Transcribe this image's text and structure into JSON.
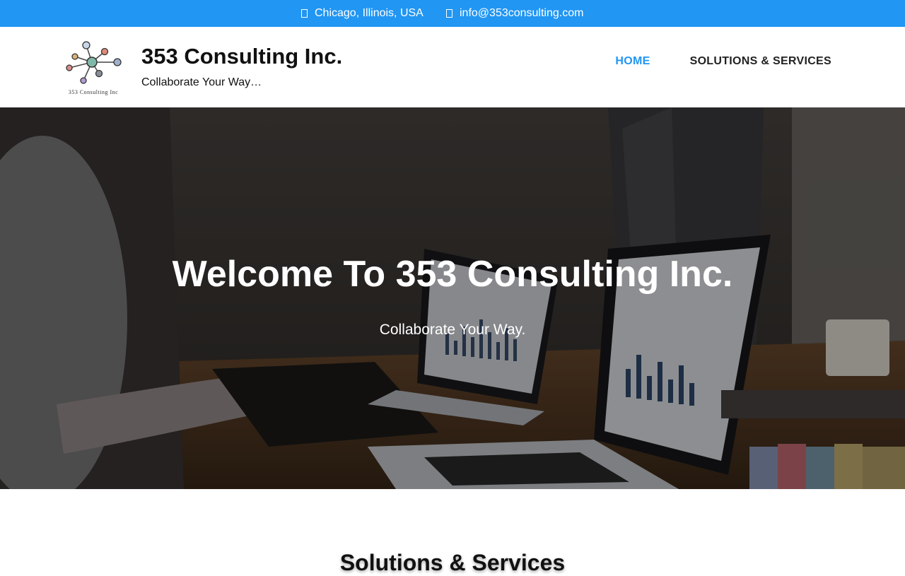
{
  "topbar": {
    "location_icon": "map-marker-icon",
    "location": "Chicago, Illinois, USA",
    "email_icon": "envelope-icon",
    "email": "info@353consulting.com",
    "bg_color": "#2196f3"
  },
  "header": {
    "logo_caption": "353 Consulting Inc",
    "title": "353 Consulting Inc.",
    "tagline": "Collaborate Your Way…"
  },
  "nav": {
    "items": [
      {
        "label": "HOME",
        "active": true
      },
      {
        "label": "SOLUTIONS & SERVICES",
        "active": false
      }
    ],
    "active_color": "#2196f3"
  },
  "hero": {
    "title": "Welcome To 353 Consulting Inc.",
    "subtitle": "Collaborate Your Way."
  },
  "section": {
    "title": "Solutions & Services"
  }
}
